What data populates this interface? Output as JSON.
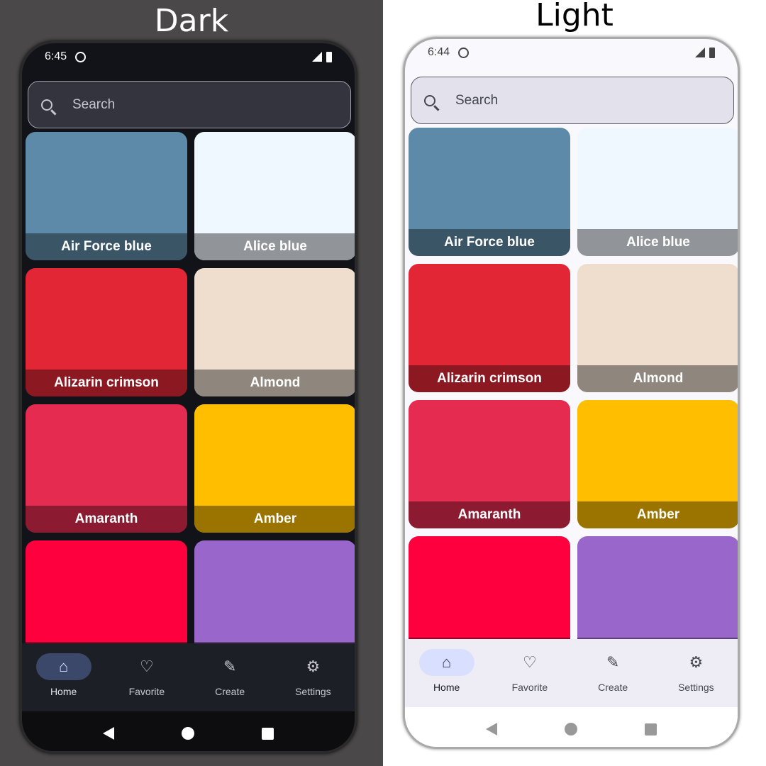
{
  "panels": [
    {
      "theme": "dark",
      "title": "Dark",
      "time": "6:45"
    },
    {
      "theme": "light",
      "title": "Light",
      "time": "6:44"
    }
  ],
  "search": {
    "placeholder": "Search"
  },
  "colors": [
    {
      "name": "Air Force blue",
      "color": "#5d8aa8",
      "band": "#3a5566"
    },
    {
      "name": "Alice blue",
      "color": "#f0f8ff",
      "band": "#919599"
    },
    {
      "name": "Alizarin crimson",
      "color": "#e32636",
      "band": "#8c1821"
    },
    {
      "name": "Almond",
      "color": "#efdecd",
      "band": "#8f877e"
    },
    {
      "name": "Amaranth",
      "color": "#e52b50",
      "band": "#8c1a31"
    },
    {
      "name": "Amber",
      "color": "#ffbf00",
      "band": "#9b7400"
    },
    {
      "name": "",
      "color": "#ff003f",
      "band": "#9c0027"
    },
    {
      "name": "",
      "color": "#9966cc",
      "band": "#5e3e7d"
    }
  ],
  "nav": [
    {
      "label": "Home",
      "icon": "home-icon",
      "glyph": "⌂",
      "active": true
    },
    {
      "label": "Favorite",
      "icon": "heart-icon",
      "glyph": "♡"
    },
    {
      "label": "Create",
      "icon": "pencil-icon",
      "glyph": "✎"
    },
    {
      "label": "Settings",
      "icon": "gear-icon",
      "glyph": "⚙"
    }
  ]
}
